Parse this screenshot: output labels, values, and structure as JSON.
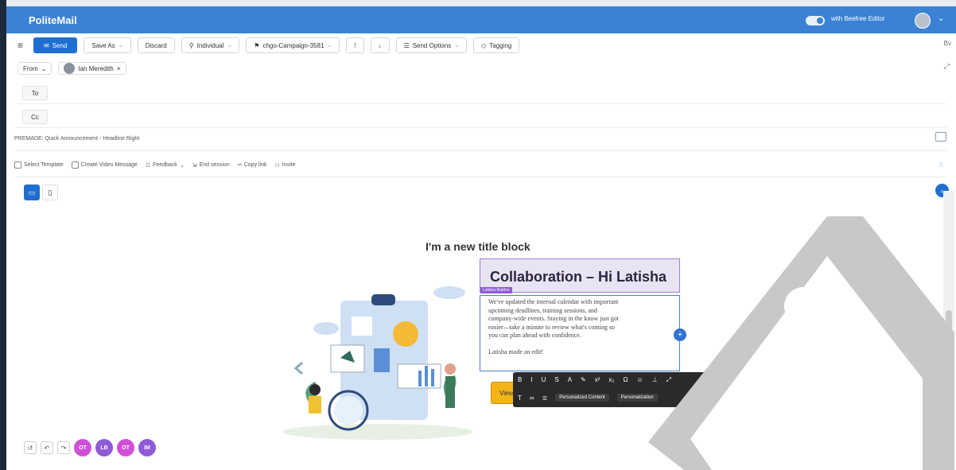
{
  "app": {
    "brand": "PoliteMail",
    "beefree_label": "with Beefree Editor"
  },
  "toolbar": {
    "send": "Send",
    "save_as": "Save As",
    "discard": "Discard",
    "individual": "Individual",
    "campaign": "chgo-Campaign-3581",
    "send_options": "Send Options",
    "tagging": "Tagging",
    "by": "Bv"
  },
  "header": {
    "from_label": "From",
    "sender": "Ian Meredith",
    "to_label": "To",
    "cc_label": "Cc",
    "subject": "PREMADE: Quick Announcement - Headline Right"
  },
  "subtools": {
    "select_template": "Select Template",
    "create_video": "Create Video Message",
    "feedback": "Feedback",
    "end_session": "End session",
    "copy_link": "Copy link",
    "invite": "Invite"
  },
  "canvas": {
    "title_block": "I'm a new title block",
    "headline": "Collaboration – Hi Latisha",
    "editor_tag": "Latisha Brathm",
    "body_lines": [
      "We've updated the internal calendar with important",
      "upcoming deadlines, training sessions, and",
      "company-wide events. Staying in the know just got",
      "easier—take a minute to review what's coming so",
      "you can plan ahead with confidence.",
      "",
      "Latisha made an edit!"
    ],
    "cta": "View"
  },
  "rte": {
    "personalized": "Personalized Content",
    "personalization": "Personalization"
  },
  "collaborators": [
    {
      "initials": "OT",
      "color": "#d04fd6"
    },
    {
      "initials": "LB",
      "color": "#8e5bd8"
    },
    {
      "initials": "OT",
      "color": "#d04fd6"
    },
    {
      "initials": "IM",
      "color": "#8e5bd8"
    }
  ],
  "colors": {
    "topbar": "#3b82d6",
    "accent": "#1f6fd1",
    "headline_bg": "#e9e4f3",
    "cta": "#f3b419"
  }
}
